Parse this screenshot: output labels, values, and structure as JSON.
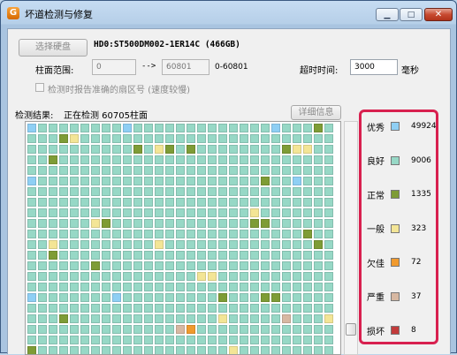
{
  "window": {
    "title": "坏道检测与修复",
    "app_icon_letter": "G",
    "minimize_glyph": "▁",
    "maximize_glyph": "□",
    "close_glyph": "✕"
  },
  "toolbar": {
    "select_disk_label": "选择硬盘",
    "disk_info": "HD0:ST500DM002-1ER14C (466GB)",
    "cyl_range_label": "柱面范围:",
    "cyl_start_value": "0",
    "arrow": "-->",
    "cyl_end_value": "60801",
    "cyl_hint": "0-60801",
    "timeout_label": "超时时间:",
    "timeout_value": "3000",
    "timeout_unit": "毫秒",
    "report_checkbox_label": "检测时报告准确的扇区号 (速度较慢)",
    "report_checked": false
  },
  "status": {
    "result_label": "检测结果:",
    "result_text": "正在检测 60705柱面",
    "details_button": "详细信息"
  },
  "legend": [
    {
      "name": "优秀",
      "color": "#8fcff4",
      "count": "49924"
    },
    {
      "name": "良好",
      "color": "#97d8c6",
      "count": "9006"
    },
    {
      "name": "正常",
      "color": "#7e9c36",
      "count": "1335"
    },
    {
      "name": "一般",
      "color": "#f3e596",
      "count": "323"
    },
    {
      "name": "欠佳",
      "color": "#f09a2e",
      "count": "72"
    },
    {
      "name": "严重",
      "color": "#d7b8a2",
      "count": "37"
    },
    {
      "name": "损坏",
      "color": "#c23b3b",
      "count": "8"
    }
  ],
  "grid_colors": {
    "A": "#8fcff4",
    "G": "#97d8c6",
    "N": "#7e9c36",
    "Y": "#f3e596",
    "O": "#f09a2e",
    "S": "#d7b8a2",
    "R": "#c23b3b",
    "W": "#ffffff"
  },
  "grid_rows": [
    "AGGGGGGGGAGGGGGGGGGGGGGAGGGNG",
    "GGGNYGGGGGGGGGGGGGGGGGGGGGGGG",
    "GGGGGGGGGGNGYNGNGGGGGGGGNYYGG",
    "GGNGGGGGGGGGGGGGGGGGGGGGGGGGG",
    "GGGGGGGGGGGGGGGGGGGGGGGGGGGGG",
    "AGGGGGGGGGGGGGGGGGGGGGNGGAGGG",
    "GGGGGGGGGGGGGGGGGGGGGGGGGGGGG",
    "GGGGGGGGGGGGGGGGGGGGGGGGGGGGG",
    "GGGGGGGGGGGGGGGGGGGGGYGGGGGGG",
    "GGGGGGYNGGGGGGGGGGGGGNNGGGGGG",
    "GGGGGGGGGGGGGGGGGGGGGGGGGGNGG",
    "GGYGGGGGGGGGYGGGGGGGGGGGGGGNG",
    "GGNGGGGGGGGGGGGGGGGGGGGGGGGGG",
    "GGGGGGNGGGGGGGGGGGGGGGGGGGGGG",
    "GGGGGGGGGGGGGGGGYYGGGGGGGGGGG",
    "GGGGGGGGGGGGGGGGGGGGGGGGGGGGG",
    "AGGGGGGGAGGGGGGGGGNGGGNNGGGGG",
    "GGGGGGGGGGGGGGGGGGGGGGGGGGGGG",
    "GGGNGGGGGGGGGGGGGGYGGGGGSGGGY",
    "GGGGGGGGGGGGGGSOGGGGGGGGGGGGG",
    "GGGGGGGGGGGGGGGGGGGGGGGGGGGGG",
    "NGGGGGGGGGGGGGGGGGGYGGGGGGGGG",
    "WWWWWWWWWWWWWWWWWWWWWWWWWWWWW"
  ]
}
